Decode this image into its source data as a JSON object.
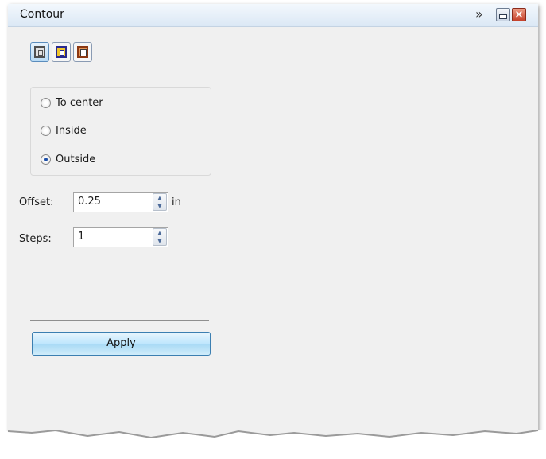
{
  "window": {
    "title": "Contour",
    "expand_label": "»",
    "close_label": "×"
  },
  "modes": [
    {
      "name": "To center",
      "icon": "contour-to-center-icon",
      "active": true
    },
    {
      "name": "Inside",
      "icon": "contour-inside-icon",
      "active": false
    },
    {
      "name": "Outside",
      "icon": "contour-outside-icon",
      "active": false
    }
  ],
  "direction": {
    "options": [
      {
        "label": "To center",
        "checked": false
      },
      {
        "label": "Inside",
        "checked": false
      },
      {
        "label": "Outside",
        "checked": true
      }
    ]
  },
  "offset": {
    "label": "Offset:",
    "value": "0.25",
    "unit": "in"
  },
  "steps": {
    "label": "Steps:",
    "value": "1"
  },
  "apply_label": "Apply",
  "colors": {
    "panel_bg": "#f0f0f0",
    "titlebar": "#dbe8f5",
    "button_accent": "#bee6fd",
    "close_red": "#c5402a"
  }
}
